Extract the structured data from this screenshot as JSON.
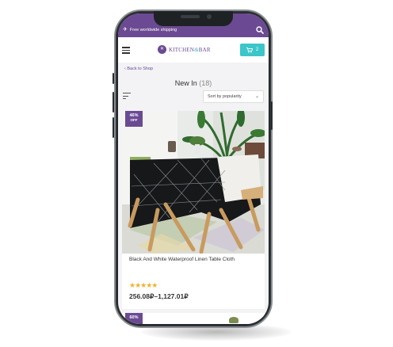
{
  "topbar": {
    "shipping_text": "Free worldwide shipping",
    "search_icon": "search-icon"
  },
  "header": {
    "logo_word1": "KITCHEN",
    "logo_amp": "&",
    "logo_word2": "BAR",
    "cart_count": "2",
    "menu_icon": "hamburger-icon",
    "cart_icon": "cart-icon"
  },
  "nav": {
    "back_label": "Back to Shop"
  },
  "listing": {
    "title": "New In",
    "count": "(18)",
    "sort_label": "Sort by popularity"
  },
  "products": [
    {
      "badge_pct": "46%",
      "badge_off": "OFF",
      "name": "Black And White Waterproof Linen Table Cloth",
      "rating": 4.5,
      "stars": "★★★★★",
      "price": "256.08₽–1,127.01₽"
    },
    {
      "badge_pct": "60%"
    }
  ],
  "colors": {
    "brand_purple": "#6b4a93",
    "cart_teal": "#3bc6c9",
    "star_gold": "#f0b32a"
  }
}
